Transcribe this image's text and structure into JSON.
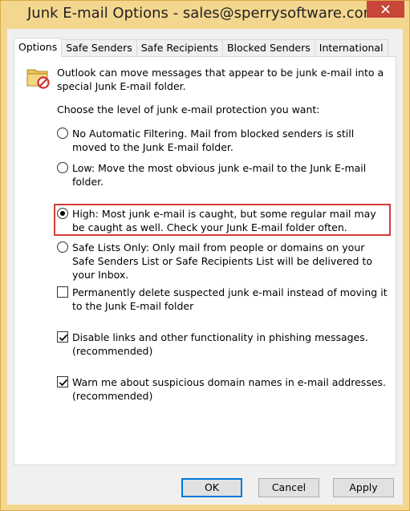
{
  "window": {
    "title": "Junk E-mail Options - sales@sperrysoftware.com",
    "accent_border": "#d6a94a",
    "frame_color": "#f4d78f",
    "close_color": "#c8463a"
  },
  "tabs": [
    {
      "label": "Options",
      "active": true
    },
    {
      "label": "Safe Senders",
      "active": false
    },
    {
      "label": "Safe Recipients",
      "active": false
    },
    {
      "label": "Blocked Senders",
      "active": false
    },
    {
      "label": "International",
      "active": false
    }
  ],
  "options_panel": {
    "intro": "Outlook can move messages that appear to be junk e-mail into a special Junk E-mail folder.",
    "choose_level": "Choose the level of junk e-mail protection you want:",
    "levels": [
      {
        "label": "No Automatic Filtering. Mail from blocked senders is still moved to the Junk E-mail folder.",
        "selected": false
      },
      {
        "label": "Low: Move the most obvious junk e-mail to the Junk E-mail folder.",
        "selected": false
      },
      {
        "label": "High: Most junk e-mail is caught, but some regular mail may be caught as well. Check your Junk E-mail folder often.",
        "selected": true
      },
      {
        "label": "Safe Lists Only: Only mail from people or domains on your Safe Senders List or Safe Recipients List will be delivered to your Inbox.",
        "selected": false
      }
    ],
    "checkboxes": [
      {
        "label": "Permanently delete suspected junk e-mail instead of moving it to the Junk E-mail folder",
        "checked": false
      },
      {
        "label": "Disable links and other functionality in phishing messages. (recommended)",
        "checked": true
      },
      {
        "label": "Warn me about suspicious domain names in e-mail addresses. (recommended)",
        "checked": true
      }
    ],
    "highlight_color": "#d53a37"
  },
  "buttons": {
    "ok": "OK",
    "cancel": "Cancel",
    "apply": "Apply"
  }
}
